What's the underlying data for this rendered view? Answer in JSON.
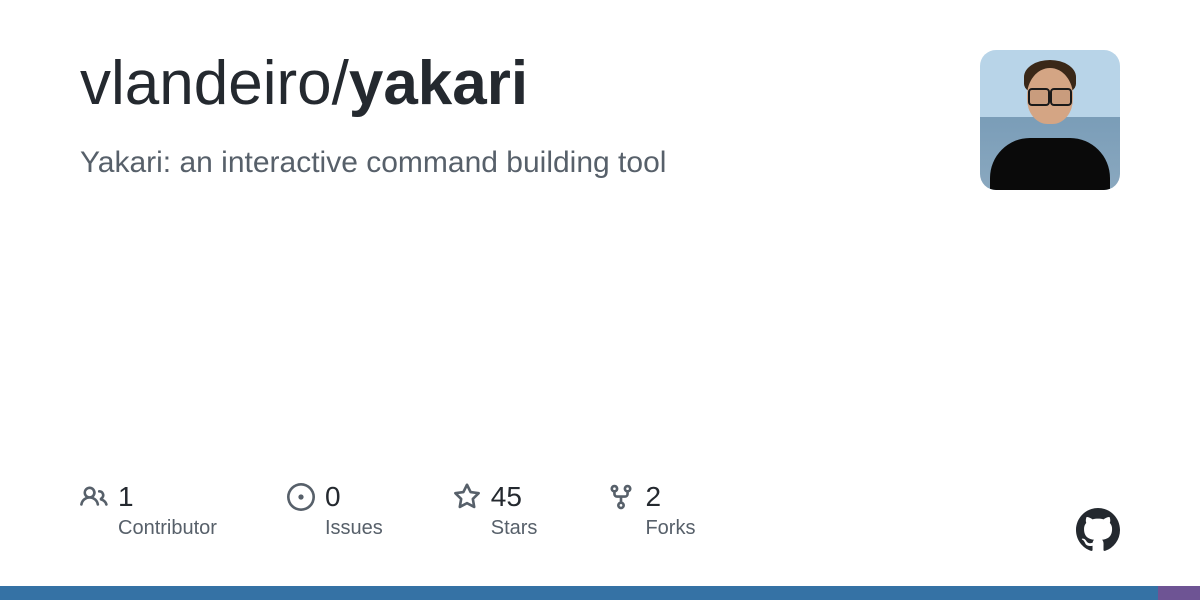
{
  "repo": {
    "owner": "vlandeiro",
    "separator": "/",
    "name": "yakari",
    "description": "Yakari: an interactive command building tool"
  },
  "stats": [
    {
      "icon": "people-icon",
      "count": "1",
      "label": "Contributor"
    },
    {
      "icon": "issue-icon",
      "count": "0",
      "label": "Issues"
    },
    {
      "icon": "star-icon",
      "count": "45",
      "label": "Stars"
    },
    {
      "icon": "fork-icon",
      "count": "2",
      "label": "Forks"
    }
  ],
  "bottom_bar": {
    "segments": [
      {
        "color": "blue",
        "width": "96.5%"
      },
      {
        "color": "purple",
        "width": "3.5%"
      }
    ]
  }
}
